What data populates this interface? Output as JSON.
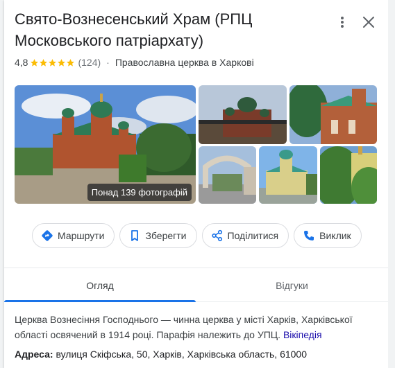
{
  "place": {
    "title": "Свято-Вознесенський Храм (РПЦ Московського патріархату)",
    "rating": "4,8",
    "rating_stars": 5,
    "review_count": "(124)",
    "separator": "·",
    "category": "Православна церква в Харкові"
  },
  "header_icons": {
    "more": "more-vert-icon",
    "close": "close-icon"
  },
  "photos": {
    "count_label": "Понад 139 фотографій"
  },
  "actions": [
    {
      "label": "Маршрути",
      "icon": "directions-icon"
    },
    {
      "label": "Зберегти",
      "icon": "bookmark-icon"
    },
    {
      "label": "Поділитися",
      "icon": "share-icon"
    },
    {
      "label": "Виклик",
      "icon": "phone-icon"
    }
  ],
  "tabs": {
    "overview": "Огляд",
    "reviews": "Відгуки",
    "active": "overview"
  },
  "description": {
    "text": "Церква Вознесіння Господнього — чинна церква у місті Харків, Харківської області освячений в 1914 році. Парафія належить до УПЦ.",
    "link": "Вікіпедія"
  },
  "address": {
    "label": "Адреса:",
    "value": "вулиця Скіфська, 50, Харків, Харківська область, 61000"
  },
  "colors": {
    "accent": "#1a73e8",
    "star": "#fbbc04",
    "link": "#1a0dab"
  }
}
